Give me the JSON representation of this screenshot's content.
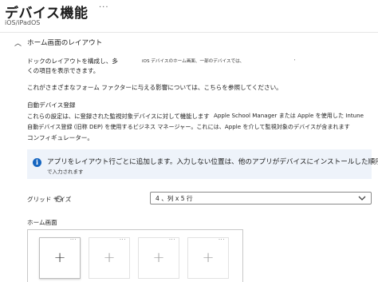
{
  "header": {
    "title": "デバイス機能",
    "more": "···",
    "subtitle": "iOS/iPadOS"
  },
  "section": {
    "chevron": "︿",
    "title": "ホーム画面のレイアウト",
    "dock_line1": "ドックのレイアウトを構成し、多",
    "dock_line2": "くの項目を表示できます。",
    "dock_side_note": "iOS デバイスのホーム画面、一部のデバイスでは、",
    "dock_side_mark": "'",
    "form_factor": "これがさまざまなフォーム ファクターに与える影響については、こちらを参照してください。",
    "auto_heading": "自動デバイス登録",
    "auto_p1": "これらの設定は、に登録された監視対象デバイスに対して機能します",
    "auto_p1b": "Apple School Manager または Apple を使用した Intune",
    "auto_p2": "自動デバイス登録 (旧称 DEP) を使用するビジネス マネージャー。これには、Apple を介して監視対象のデバイスが含まれます",
    "auto_p3": "コンフィギュレーター。"
  },
  "banner": {
    "icon": "info-icon",
    "line1": "アプリをレイアウト行ごとに追加します。入力しない位置は、他のアプリがデバイスにインストールした順序",
    "line2": "で入力されます",
    "color": "#eef3fa",
    "icon_color": "#1565c0"
  },
  "grid": {
    "label": "グリッド サイズ",
    "info_glyph": "i",
    "value": "4 、列 x 5 行",
    "chevron_icon": "chevron-down-icon"
  },
  "home": {
    "label": "ホーム画面",
    "tiles": [
      {
        "more": "···",
        "plus": "+"
      },
      {
        "more": "···",
        "plus": "+"
      },
      {
        "more": "···",
        "plus": "+"
      },
      {
        "more": "···",
        "plus": "+"
      }
    ]
  }
}
